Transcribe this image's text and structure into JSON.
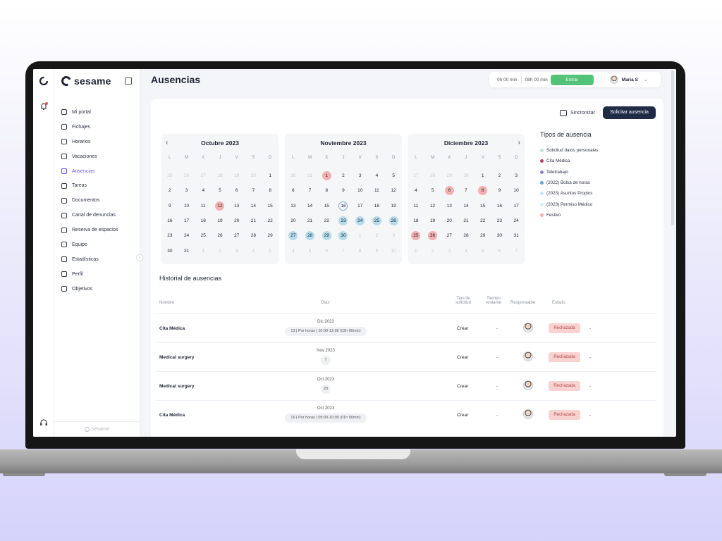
{
  "app": {
    "brand": "sesame",
    "page_title": "Ausencias",
    "footer_brand": "sesame"
  },
  "topbar": {
    "time_worked": "0h 00 min",
    "time_expected": "08h 00 min",
    "enter_label": "Entrar",
    "user_name": "María S"
  },
  "sidebar": {
    "items": [
      {
        "label": "Mi portal",
        "icon": "dashboard-icon"
      },
      {
        "label": "Fichajes",
        "icon": "clock-icon"
      },
      {
        "label": "Horarios",
        "icon": "calendar-clock-icon"
      },
      {
        "label": "Vacaciones",
        "icon": "beach-icon"
      },
      {
        "label": "Ausencias",
        "icon": "absence-icon",
        "active": true
      },
      {
        "label": "Tareas",
        "icon": "tasks-icon"
      },
      {
        "label": "Documentos",
        "icon": "documents-icon"
      },
      {
        "label": "Canal de denuncias",
        "icon": "megaphone-icon"
      },
      {
        "label": "Reserva de espacios",
        "icon": "pin-icon"
      },
      {
        "label": "Equipo",
        "icon": "shield-icon"
      },
      {
        "label": "Estadísticas",
        "icon": "stats-icon"
      },
      {
        "label": "Perfil",
        "icon": "user-icon"
      },
      {
        "label": "Objetivos",
        "icon": "target-icon"
      }
    ]
  },
  "actions": {
    "sync_label": "Sincronizar",
    "request_label": "Solicitar ausencia"
  },
  "weekday_headers": [
    "L",
    "M",
    "X",
    "J",
    "V",
    "S",
    "D"
  ],
  "calendars": [
    {
      "month": "Octubre 2023",
      "days": [
        [
          "25",
          "o"
        ],
        [
          "26",
          "o"
        ],
        [
          "27",
          "o"
        ],
        [
          "28",
          "o"
        ],
        [
          "29",
          "o"
        ],
        [
          "30",
          "o"
        ],
        [
          "1",
          ""
        ],
        [
          "2",
          ""
        ],
        [
          "3",
          ""
        ],
        [
          "4",
          ""
        ],
        [
          "5",
          ""
        ],
        [
          "6",
          ""
        ],
        [
          "7",
          ""
        ],
        [
          "8",
          ""
        ],
        [
          "9",
          ""
        ],
        [
          "10",
          ""
        ],
        [
          "11",
          ""
        ],
        [
          "12",
          "red"
        ],
        [
          "13",
          ""
        ],
        [
          "14",
          ""
        ],
        [
          "15",
          ""
        ],
        [
          "16",
          ""
        ],
        [
          "17",
          ""
        ],
        [
          "18",
          ""
        ],
        [
          "19",
          ""
        ],
        [
          "20",
          ""
        ],
        [
          "21",
          ""
        ],
        [
          "22",
          ""
        ],
        [
          "23",
          ""
        ],
        [
          "24",
          ""
        ],
        [
          "25",
          ""
        ],
        [
          "26",
          ""
        ],
        [
          "27",
          ""
        ],
        [
          "28",
          ""
        ],
        [
          "29",
          ""
        ],
        [
          "30",
          ""
        ],
        [
          "31",
          ""
        ],
        [
          "1",
          "o"
        ],
        [
          "2",
          "o"
        ],
        [
          "3",
          "o"
        ],
        [
          "4",
          "o"
        ],
        [
          "5",
          "o"
        ]
      ]
    },
    {
      "month": "Noviembre 2023",
      "days": [
        [
          "30",
          "o"
        ],
        [
          "31",
          "o"
        ],
        [
          "1",
          "red"
        ],
        [
          "2",
          ""
        ],
        [
          "3",
          ""
        ],
        [
          "4",
          ""
        ],
        [
          "5",
          ""
        ],
        [
          "6",
          ""
        ],
        [
          "7",
          ""
        ],
        [
          "8",
          ""
        ],
        [
          "9",
          ""
        ],
        [
          "10",
          ""
        ],
        [
          "11",
          ""
        ],
        [
          "12",
          ""
        ],
        [
          "13",
          ""
        ],
        [
          "14",
          ""
        ],
        [
          "15",
          ""
        ],
        [
          "16",
          "ring"
        ],
        [
          "17",
          ""
        ],
        [
          "18",
          ""
        ],
        [
          "19",
          ""
        ],
        [
          "20",
          ""
        ],
        [
          "21",
          ""
        ],
        [
          "22",
          ""
        ],
        [
          "23",
          "blue"
        ],
        [
          "24",
          "blue"
        ],
        [
          "25",
          "blue"
        ],
        [
          "26",
          "blue"
        ],
        [
          "27",
          "blue"
        ],
        [
          "28",
          "blue"
        ],
        [
          "29",
          "blue"
        ],
        [
          "30",
          "blue"
        ],
        [
          "1",
          "o"
        ],
        [
          "2",
          "o"
        ],
        [
          "3",
          "o"
        ],
        [
          "4",
          "o"
        ],
        [
          "5",
          "o"
        ],
        [
          "6",
          "o"
        ],
        [
          "7",
          "o"
        ],
        [
          "8",
          "o"
        ],
        [
          "9",
          "o"
        ],
        [
          "10",
          "o"
        ]
      ]
    },
    {
      "month": "Diciembre 2023",
      "days": [
        [
          "27",
          "o"
        ],
        [
          "28",
          "o"
        ],
        [
          "29",
          "o"
        ],
        [
          "30",
          "o"
        ],
        [
          "1",
          ""
        ],
        [
          "2",
          ""
        ],
        [
          "3",
          ""
        ],
        [
          "4",
          ""
        ],
        [
          "5",
          ""
        ],
        [
          "6",
          "red"
        ],
        [
          "7",
          ""
        ],
        [
          "8",
          "red"
        ],
        [
          "9",
          ""
        ],
        [
          "10",
          ""
        ],
        [
          "11",
          ""
        ],
        [
          "12",
          ""
        ],
        [
          "13",
          ""
        ],
        [
          "14",
          ""
        ],
        [
          "15",
          ""
        ],
        [
          "16",
          ""
        ],
        [
          "17",
          ""
        ],
        [
          "18",
          ""
        ],
        [
          "19",
          ""
        ],
        [
          "20",
          ""
        ],
        [
          "21",
          ""
        ],
        [
          "22",
          ""
        ],
        [
          "23",
          ""
        ],
        [
          "24",
          ""
        ],
        [
          "25",
          "red"
        ],
        [
          "26",
          "red"
        ],
        [
          "27",
          ""
        ],
        [
          "28",
          ""
        ],
        [
          "29",
          ""
        ],
        [
          "30",
          ""
        ],
        [
          "31",
          ""
        ],
        [
          "1",
          "o"
        ],
        [
          "2",
          "o"
        ],
        [
          "3",
          "o"
        ],
        [
          "4",
          "o"
        ],
        [
          "5",
          "o"
        ],
        [
          "6",
          "o"
        ],
        [
          "7",
          "o"
        ]
      ]
    }
  ],
  "absence_types": {
    "title": "Tipos de ausencia",
    "items": [
      {
        "label": "Solicitud datos personales",
        "color": "#b9e6d3"
      },
      {
        "label": "Cita Médica",
        "color": "#b5485f"
      },
      {
        "label": "Teletrabajo",
        "color": "#8f7fd6"
      },
      {
        "label": "(2022) Bolsa de horas",
        "color": "#5aa9d6"
      },
      {
        "label": "(2023) Asuntos Propios",
        "color": "#bfe3f0"
      },
      {
        "label": "(2023) Permiso Médico",
        "color": "#cdeef4"
      },
      {
        "label": "Festivo",
        "color": "#f2b1b0"
      }
    ]
  },
  "history": {
    "title": "Historial de ausencias",
    "headers": {
      "name": "Nombre",
      "days": "Días",
      "request_type": "Tipo de solicitud",
      "remaining": "Tiempo restante",
      "responsible": "Responsable",
      "status": "Estado"
    },
    "rows": [
      {
        "name": "Cita Médica",
        "month": "Dic 2023",
        "detail": "13 | Por horas | 10:00-12:00 (02h 00min)",
        "type": "Crear",
        "remaining": "-",
        "status": "Rechazada",
        "extra": "-"
      },
      {
        "name": "Medical surgery",
        "month": "Nov 2023",
        "detail": "7",
        "type": "Crear",
        "remaining": "-",
        "status": "Rechazada",
        "extra": "-"
      },
      {
        "name": "Medical surgery",
        "month": "Oct 2023",
        "detail": "20",
        "type": "Crear",
        "remaining": "-",
        "status": "Rechazada",
        "extra": "-"
      },
      {
        "name": "Cita Médica",
        "month": "Oct 2023",
        "detail": "16 | Por horas | 09:00-10:00 (01h 00min)",
        "type": "Crear",
        "remaining": "-",
        "status": "Rechazada",
        "extra": "-"
      }
    ]
  }
}
